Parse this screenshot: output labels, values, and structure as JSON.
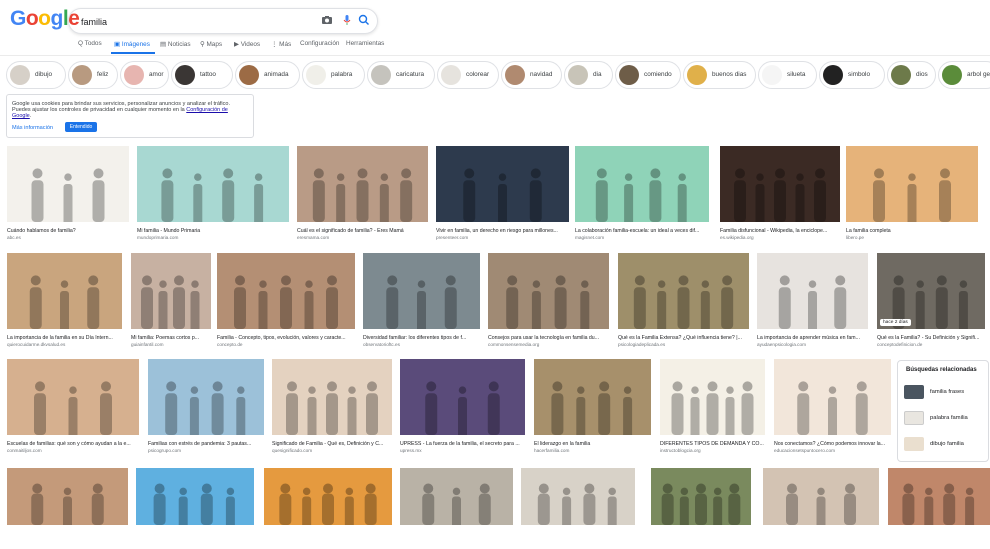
{
  "header": {
    "logo_letters": [
      "G",
      "o",
      "o",
      "g",
      "l",
      "e"
    ],
    "logo_colors": [
      "#4285f4",
      "#ea4335",
      "#fbbc05",
      "#4285f4",
      "#34a853",
      "#ea4335"
    ],
    "search_value": "familia"
  },
  "tabs": [
    "Q Todos",
    "Imágenes",
    "Noticias",
    "Maps",
    "Videos",
    "⋮ Más",
    "Configuración",
    "Herramientas"
  ],
  "chips": [
    "dibujo",
    "feliz",
    "amor",
    "tattoo",
    "animada",
    "palabra",
    "caricatura",
    "colorear",
    "navidad",
    "dia",
    "comiendo",
    "buenos dias",
    "silueta",
    "simbolo",
    "dios",
    "arbol ge"
  ],
  "cookie": {
    "text_pre": "Google usa cookies para brindar sus servicios, personalizar anuncios y analizar el tráfico. Puedes ajustar los controles de privacidad en cualquier momento en la ",
    "link": "Configuración de Google",
    "text_post": ".",
    "more": "Más información",
    "ok": "Entendido"
  },
  "rows": [
    [
      {
        "cap": "Cuándo hablamos de familia?",
        "src": "abc.es",
        "bg": "#f3f1ec"
      },
      {
        "cap": "Mi familia - Mundo Primaria",
        "src": "mundoprimaria.com",
        "bg": "#a8d8d2"
      },
      {
        "cap": "Cuál es el significado de familia? - Eres Mamá",
        "src": "eresmama.com",
        "bg": "#b99b86"
      },
      {
        "cap": "Vivir en familia, un derecho en riesgo para millones...",
        "src": "presenteer.com",
        "bg": "#2d3a4d"
      },
      {
        "cap": "La colaboración familia-escuela: un ideal a veces dif...",
        "src": "magisnet.com",
        "bg": "#8fd3b8"
      },
      {
        "cap": "Familia disfuncional - Wikipedia, la enciclope...",
        "src": "es.wikipedia.org",
        "bg": "#3b2a24"
      },
      {
        "cap": "La familia completa",
        "src": "libero.pe",
        "bg": "#e6b37a"
      }
    ],
    [
      {
        "cap": "La importancia de la familia en su Día Intern...",
        "src": "quierocuidarme.dkvsalud.es",
        "bg": "#c9a57e"
      },
      {
        "cap": "Mi familia: Poemas cortos p...",
        "src": "guiainfantil.com",
        "bg": "#c7b1a2"
      },
      {
        "cap": "Familia - Concepto, tipos, evolución, valores y caracte...",
        "src": "concepto.de",
        "bg": "#b48f74"
      },
      {
        "cap": "Diversidad familiar: los diferentes tipos de f...",
        "src": "observatorioftc.es",
        "bg": "#7d8a90"
      },
      {
        "cap": "Consejos para usar la tecnología en familia du...",
        "src": "commonsensemedia.org",
        "bg": "#a08a74"
      },
      {
        "cap": "Qué es la Familia Extensa? ¿Qué influencia tiene? |...",
        "src": "psicologiadeplicada.es",
        "bg": "#9e8f6a"
      },
      {
        "cap": "La importancia de aprender música en fam...",
        "src": "ayudaenpsicologia.com",
        "bg": "#e7e3df"
      },
      {
        "cap": "Qué es la Familia? - Su Definición y Signifi...",
        "src": "conceptodefinicion.de",
        "bg": "#6f6a62",
        "badge": "hace 2 días"
      }
    ],
    [
      {
        "cap": "Escuelas de familias: qué son y cómo ayudan a la e...",
        "src": "conmaitiljos.com",
        "bg": "#d6b08f"
      },
      {
        "cap": "Familias con estrés de pandemia: 3 pautas...",
        "src": "psicogrupo.com",
        "bg": "#9cc1d9"
      },
      {
        "cap": "Significado de Familia - Qué es, Definición y C...",
        "src": "quesignificado.com",
        "bg": "#e4d2c0"
      },
      {
        "cap": "UPRESS - La fuerza de la familia, el secreto para ...",
        "src": "upress.mx",
        "bg": "#5a4b7a"
      },
      {
        "cap": "El liderazgo en la familia",
        "src": "hacerfamilia.com",
        "bg": "#a7906b"
      },
      {
        "cap": "DIFERENTES TIPOS DE DEMANDA Y CO...",
        "src": "instructoblogcia.org",
        "bg": "#f4f0e6"
      },
      {
        "cap": "Nos conectamos? ¿Cómo podemos innovar la...",
        "src": "educacionsetspuntocero.com",
        "bg": "#f2e6da"
      }
    ],
    [
      {
        "cap": "",
        "src": "",
        "bg": "#c49a7a"
      },
      {
        "cap": "",
        "src": "",
        "bg": "#5fb0e0"
      },
      {
        "cap": "",
        "src": "",
        "bg": "#e59a3f"
      },
      {
        "cap": "",
        "src": "",
        "bg": "#b9b2a6"
      },
      {
        "cap": "",
        "src": "",
        "bg": "#d8d2c8"
      },
      {
        "cap": "",
        "src": "",
        "bg": "#7a8a5e"
      },
      {
        "cap": "",
        "src": "",
        "bg": "#d3c3b3"
      },
      {
        "cap": "",
        "src": "",
        "bg": "#c0876a"
      }
    ]
  ],
  "related": {
    "title": "Búsquedas relacionadas",
    "items": [
      "familia frases",
      "palabra familia",
      "dibujo familia"
    ]
  }
}
